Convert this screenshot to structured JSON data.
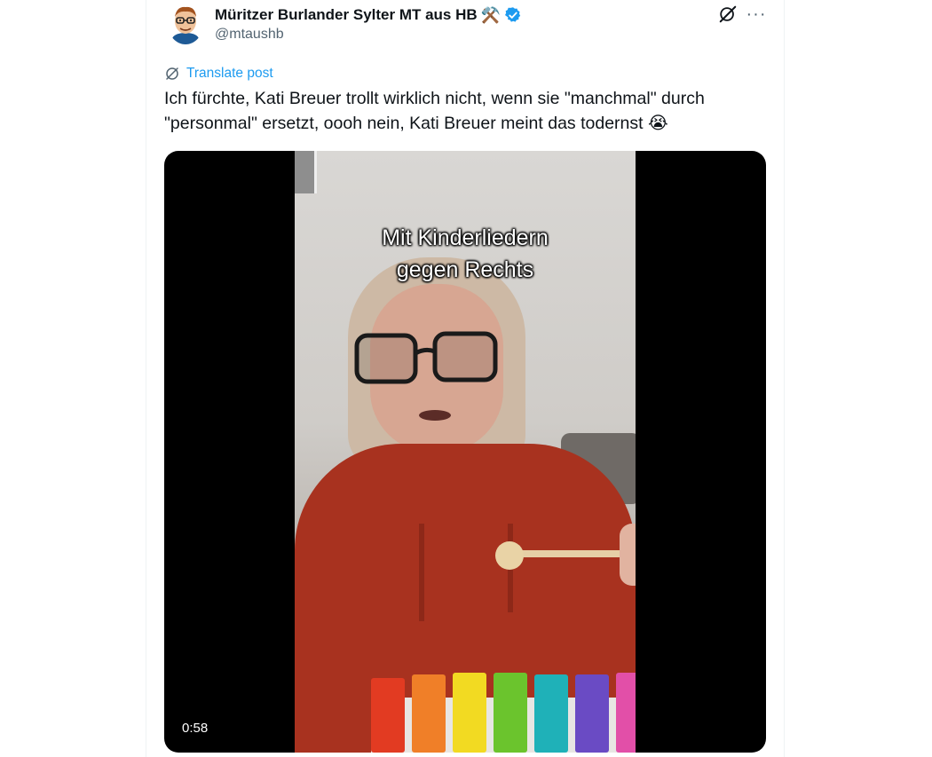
{
  "post": {
    "author_name": "Müritzer Burlander Sylter MT aus HB",
    "name_emoji": "⚒️",
    "handle": "@mtaushb",
    "translate_label": "Translate post",
    "text": "Ich fürchte, Kati Breuer trollt wirklich nicht, wenn sie \"manchmal\" durch \"personmal\" ersetzt, oooh nein, Kati Breuer meint das todernst 😭"
  },
  "media": {
    "overlay_line1": "Mit Kinderliedern",
    "overlay_line2": "gegen Rechts",
    "duration": "0:58"
  },
  "icons": {
    "verified": "verified-badge-icon",
    "grok": "grok-icon",
    "more": "more-icon",
    "translate": "translate-icon"
  },
  "colors": {
    "accent": "#1d9bf0",
    "text": "#0f1419",
    "secondary": "#536471",
    "sweater": "#a8321f"
  }
}
